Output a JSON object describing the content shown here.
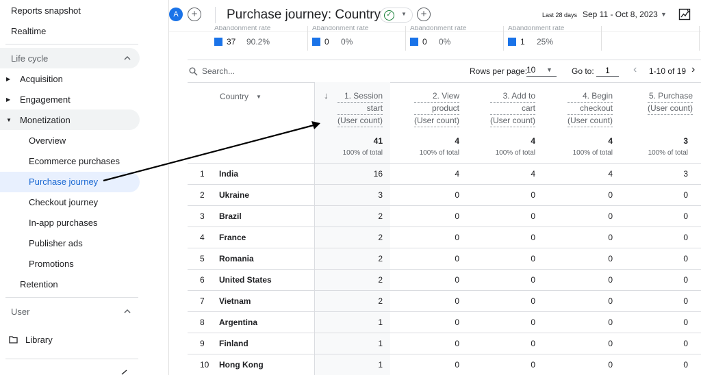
{
  "sidebar": {
    "reports_snapshot": "Reports snapshot",
    "realtime": "Realtime",
    "lifecycle_label": "Life cycle",
    "acquisition": "Acquisition",
    "engagement": "Engagement",
    "monetization": "Monetization",
    "sub_items": [
      {
        "label": "Overview",
        "active": false
      },
      {
        "label": "Ecommerce purchases",
        "active": false
      },
      {
        "label": "Purchase journey",
        "active": true
      },
      {
        "label": "Checkout journey",
        "active": false
      },
      {
        "label": "In-app purchases",
        "active": false
      },
      {
        "label": "Publisher ads",
        "active": false
      },
      {
        "label": "Promotions",
        "active": false
      }
    ],
    "retention": "Retention",
    "user_label": "User",
    "library": "Library"
  },
  "header": {
    "avatar_letter": "A",
    "title": "Purchase journey: Country",
    "date_label": "Last 28 days",
    "date_range": "Sep 11 - Oct 8, 2023"
  },
  "abandonment": {
    "label": "Abandonment rate",
    "cells": [
      {
        "value": "37",
        "pct": "90.2%"
      },
      {
        "value": "0",
        "pct": "0%"
      },
      {
        "value": "0",
        "pct": "0%"
      },
      {
        "value": "1",
        "pct": "25%"
      }
    ]
  },
  "toolbar": {
    "search_placeholder": "Search...",
    "rows_per_page_label": "Rows per page:",
    "rows_per_page_value": "10",
    "goto_label": "Go to:",
    "goto_value": "1",
    "pagination_text": "1-10 of 19"
  },
  "table": {
    "country_header": "Country",
    "columns": [
      {
        "l1": "1. Session",
        "l2": "start",
        "l3": "(User count)"
      },
      {
        "l1": "2. View",
        "l2": "product",
        "l3": "(User count)"
      },
      {
        "l1": "3. Add to",
        "l2": "cart",
        "l3": "(User count)"
      },
      {
        "l1": "4. Begin",
        "l2": "checkout",
        "l3": "(User count)"
      },
      {
        "l1": "5. Purchase",
        "l2": "(User count)",
        "l3": ""
      }
    ],
    "totals": [
      "41",
      "4",
      "4",
      "4",
      "3"
    ],
    "totals_sub": "100% of total",
    "rows": [
      {
        "idx": "1",
        "country": "India",
        "values": [
          "16",
          "4",
          "4",
          "4",
          "3"
        ]
      },
      {
        "idx": "2",
        "country": "Ukraine",
        "values": [
          "3",
          "0",
          "0",
          "0",
          "0"
        ]
      },
      {
        "idx": "3",
        "country": "Brazil",
        "values": [
          "2",
          "0",
          "0",
          "0",
          "0"
        ]
      },
      {
        "idx": "4",
        "country": "France",
        "values": [
          "2",
          "0",
          "0",
          "0",
          "0"
        ]
      },
      {
        "idx": "5",
        "country": "Romania",
        "values": [
          "2",
          "0",
          "0",
          "0",
          "0"
        ]
      },
      {
        "idx": "6",
        "country": "United States",
        "values": [
          "2",
          "0",
          "0",
          "0",
          "0"
        ]
      },
      {
        "idx": "7",
        "country": "Vietnam",
        "values": [
          "2",
          "0",
          "0",
          "0",
          "0"
        ]
      },
      {
        "idx": "8",
        "country": "Argentina",
        "values": [
          "1",
          "0",
          "0",
          "0",
          "0"
        ]
      },
      {
        "idx": "9",
        "country": "Finland",
        "values": [
          "1",
          "0",
          "0",
          "0",
          "0"
        ]
      },
      {
        "idx": "10",
        "country": "Hong Kong",
        "values": [
          "1",
          "0",
          "0",
          "0",
          "0"
        ]
      }
    ]
  },
  "colors": {
    "accent": "#1a73e8",
    "active_bg": "#e8f0fe",
    "success": "#188038"
  }
}
